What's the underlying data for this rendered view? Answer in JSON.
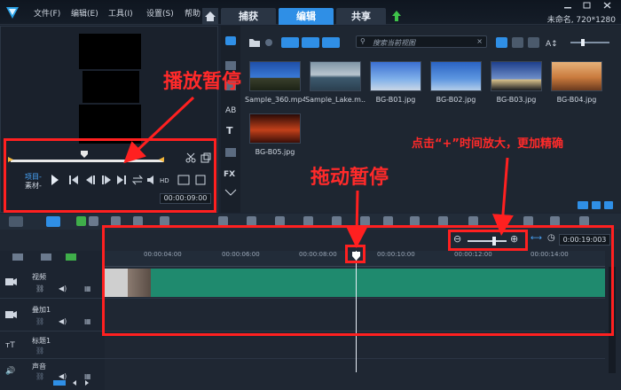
{
  "menu": [
    "文件(F)",
    "编辑(E)",
    "工具(I)",
    "设置(S)",
    "帮助"
  ],
  "tabs": [
    "捕获",
    "编辑",
    "共享"
  ],
  "project_info": "未命名, 720*1280",
  "preview": {
    "mode_project": "项目-",
    "mode_clip": "素材-",
    "timecode": "00:00:09:00"
  },
  "library": {
    "search_placeholder": "搜索当前视图",
    "items": [
      {
        "name": "Sample_360.mp4"
      },
      {
        "name": "Sample_Lake.m..."
      },
      {
        "name": "BG-B01.jpg"
      },
      {
        "name": "BG-B02.jpg"
      },
      {
        "name": "BG-B03.jpg"
      },
      {
        "name": "BG-B04.jpg"
      },
      {
        "name": "BG-B05.jpg"
      }
    ]
  },
  "timeline": {
    "timecode": "0:00:19:003",
    "ruler": [
      "00:00:04:00",
      "00:00:06:00",
      "00:00:08:00",
      "00:00:10:00",
      "00:00:12:00",
      "00:00:14:00"
    ],
    "tracks": [
      "视频",
      "叠加1",
      "标题1",
      "声音"
    ]
  },
  "annotations": {
    "pause_play": "播放暂停",
    "drag_pause": "拖动暂停",
    "zoom_tip": "点击“+”时间放大，更加精确"
  },
  "colors": {
    "accent": "#2f8fe6",
    "annotation": "#ff2020",
    "clip": "#1f8a6e"
  }
}
